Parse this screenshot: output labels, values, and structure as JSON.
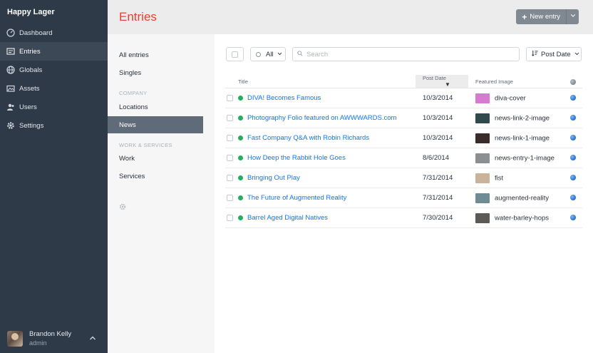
{
  "site": {
    "name": "Happy Lager"
  },
  "nav": [
    {
      "label": "Dashboard",
      "icon": "dashboard-icon"
    },
    {
      "label": "Entries",
      "icon": "entries-icon",
      "active": true
    },
    {
      "label": "Globals",
      "icon": "globe-icon"
    },
    {
      "label": "Assets",
      "icon": "assets-icon"
    },
    {
      "label": "Users",
      "icon": "users-icon"
    },
    {
      "label": "Settings",
      "icon": "gear-icon"
    }
  ],
  "user": {
    "name": "Brandon Kelly",
    "role": "admin"
  },
  "header": {
    "title": "Entries",
    "new_entry_label": "New entry"
  },
  "sources": {
    "all_entries": "All entries",
    "singles": "Singles",
    "company_heading": "COMPANY",
    "locations": "Locations",
    "news": "News",
    "work_services_heading": "WORK & SERVICES",
    "work": "Work",
    "services": "Services"
  },
  "toolbar": {
    "status_label": "All",
    "search_placeholder": "Search",
    "sort_label": "Post Date"
  },
  "table": {
    "columns": {
      "title": "Title",
      "post_date": "Post Date",
      "featured_image": "Featured Image"
    },
    "rows": [
      {
        "title": "DIVA! Becomes Famous",
        "date": "10/3/2014",
        "image": "diva-cover",
        "thumb_color": "#d77bd0"
      },
      {
        "title": "Photography Folio featured on AWWWARDS.com",
        "date": "10/3/2014",
        "image": "news-link-2-image",
        "thumb_color": "#2f4a4d"
      },
      {
        "title": "Fast Company Q&A with Robin Richards",
        "date": "10/3/2014",
        "image": "news-link-1-image",
        "thumb_color": "#3a2c28"
      },
      {
        "title": "How Deep the Rabbit Hole Goes",
        "date": "8/6/2014",
        "image": "news-entry-1-image",
        "thumb_color": "#8c8f91"
      },
      {
        "title": "Bringing Out Play",
        "date": "7/31/2014",
        "image": "fist",
        "thumb_color": "#c9b39b"
      },
      {
        "title": "The Future of Augmented Reality",
        "date": "7/31/2014",
        "image": "augmented-reality",
        "thumb_color": "#6f8b93"
      },
      {
        "title": "Barrel Aged Digital Natives",
        "date": "7/30/2014",
        "image": "water-barley-hops",
        "thumb_color": "#5d5a55"
      }
    ]
  },
  "colors": {
    "sidebar": "#2f3a48",
    "accent": "#e5422b",
    "link": "#0d78f2",
    "status_live": "#27ab60"
  }
}
